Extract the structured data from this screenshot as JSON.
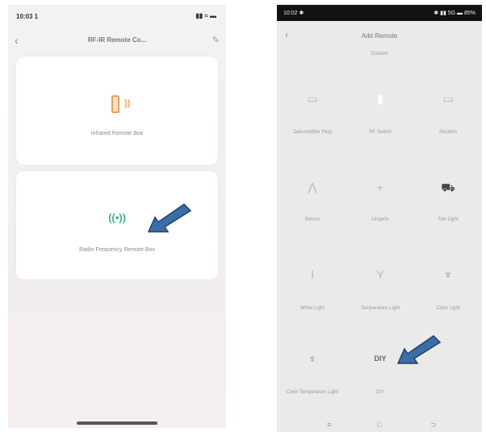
{
  "left": {
    "status_time": "10:03 1",
    "status_icons": "▮▮ ≈ ▬",
    "nav": {
      "back": "‹",
      "title": "RF-IR Remote Co...",
      "edit": "✎"
    },
    "cards": [
      {
        "label": "Infrared Remote Box"
      },
      {
        "label": "Radio Frequency Remote Box",
        "icon_text": "((•))"
      }
    ]
  },
  "right": {
    "status_time": "10:02 ✱",
    "status_icons": "✱ ▮▮ 5G  ▬ 85%",
    "nav": {
      "back": "‹",
      "title": "Add Remote"
    },
    "section": "Custom",
    "items": [
      {
        "icon": "▭",
        "label": "Dehumidifier Plug"
      },
      {
        "icon": "▮",
        "label": "RF Switch"
      },
      {
        "icon": "▭",
        "label": "Shutters"
      },
      {
        "icon": "⋀",
        "label": "Sensor"
      },
      {
        "icon": "+",
        "label": "Lingerie"
      },
      {
        "icon": "⛟",
        "label": "Fan Light"
      },
      {
        "icon": "Ⅰ",
        "label": "White Light"
      },
      {
        "icon": "Y",
        "label": "Temperature Light"
      },
      {
        "icon": "♆",
        "label": "Color Light"
      },
      {
        "icon": "♆",
        "label": "Color Temperature Light"
      },
      {
        "icon": "DIY",
        "label": "DIY"
      }
    ],
    "bottom_nav": [
      "≡",
      "□",
      "⊃"
    ]
  }
}
